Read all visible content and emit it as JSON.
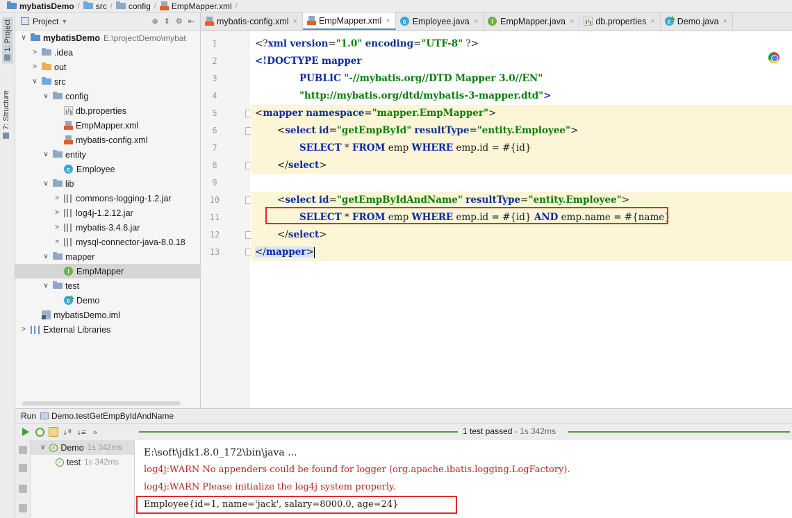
{
  "breadcrumb": {
    "items": [
      "mybatisDemo",
      "src",
      "config",
      "EmpMapper.xml"
    ]
  },
  "tool_strip": {
    "project_tab": "1: Project",
    "structure_tab": "7: Structure"
  },
  "project_panel": {
    "title": "Project",
    "tree": [
      {
        "label": "mybatisDemo",
        "hint": "E:\\projectDemo\\mybat",
        "level": 0,
        "icon": "module-folder-icon",
        "expanded": true
      },
      {
        "label": ".idea",
        "level": 1,
        "icon": "folder-icon",
        "expanded": false
      },
      {
        "label": "out",
        "level": 1,
        "icon": "orange-folder-icon",
        "expanded": false
      },
      {
        "label": "src",
        "level": 1,
        "icon": "source-folder-icon",
        "expanded": true
      },
      {
        "label": "config",
        "level": 2,
        "icon": "folder-icon",
        "expanded": true
      },
      {
        "label": "db.properties",
        "level": 3,
        "icon": "properties-file-icon"
      },
      {
        "label": "EmpMapper.xml",
        "level": 3,
        "icon": "xml-file-icon"
      },
      {
        "label": "mybatis-config.xml",
        "level": 3,
        "icon": "xml-file-icon"
      },
      {
        "label": "entity",
        "level": 2,
        "icon": "folder-icon",
        "expanded": true
      },
      {
        "label": "Employee",
        "level": 3,
        "icon": "class-icon"
      },
      {
        "label": "lib",
        "level": 2,
        "icon": "folder-icon",
        "expanded": true
      },
      {
        "label": "commons-logging-1.2.jar",
        "level": 3,
        "icon": "jar-icon",
        "expanded": false
      },
      {
        "label": "log4j-1.2.12.jar",
        "level": 3,
        "icon": "jar-icon",
        "expanded": false
      },
      {
        "label": "mybatis-3.4.6.jar",
        "level": 3,
        "icon": "jar-icon",
        "expanded": false
      },
      {
        "label": "mysql-connector-java-8.0.18",
        "level": 3,
        "icon": "jar-icon",
        "expanded": false
      },
      {
        "label": "mapper",
        "level": 2,
        "icon": "folder-icon",
        "expanded": true
      },
      {
        "label": "EmpMapper",
        "level": 3,
        "icon": "interface-icon",
        "selected": true
      },
      {
        "label": "test",
        "level": 2,
        "icon": "folder-icon",
        "expanded": true
      },
      {
        "label": "Demo",
        "level": 3,
        "icon": "test-class-icon"
      },
      {
        "label": "mybatisDemo.iml",
        "level": 1,
        "icon": "iml-file-icon"
      },
      {
        "label": "External Libraries",
        "level": 0,
        "icon": "external-libraries-icon",
        "expanded": false
      }
    ]
  },
  "editor_tabs": [
    {
      "label": "mybatis-config.xml",
      "icon": "xml-file-icon",
      "active": false
    },
    {
      "label": "EmpMapper.xml",
      "icon": "xml-file-icon",
      "active": true
    },
    {
      "label": "Employee.java",
      "icon": "class-icon",
      "active": false
    },
    {
      "label": "EmpMapper.java",
      "icon": "interface-icon",
      "active": false
    },
    {
      "label": "db.properties",
      "icon": "properties-file-icon",
      "active": false
    },
    {
      "label": "Demo.java",
      "icon": "test-class-icon",
      "active": false
    }
  ],
  "editor": {
    "line_numbers": [
      "1",
      "2",
      "3",
      "4",
      "5",
      "6",
      "7",
      "8",
      "9",
      "10",
      "11",
      "12",
      "13"
    ],
    "lines": {
      "l1": {
        "open": "<?",
        "tag": "xml",
        "a1": "version",
        "v1": "\"1.0\"",
        "a2": "encoding",
        "v2": "\"UTF-8\"",
        "close": " ?>"
      },
      "l2": {
        "open": "<!",
        "tag": "DOCTYPE",
        "name": "mapper"
      },
      "l3": {
        "kw": "PUBLIC",
        "val": "\"-//mybatis.org//DTD Mapper 3.0//EN\""
      },
      "l4": {
        "val": "\"http://mybatis.org/dtd/mybatis-3-mapper.dtd\"",
        "close": ">"
      },
      "l5": {
        "tag": "mapper",
        "attr": "namespace",
        "val": "\"mapper.EmpMapper\""
      },
      "l6": {
        "tag": "select",
        "a1": "id",
        "v1": "\"getEmpById\"",
        "a2": "resultType",
        "v2": "\"entity.Employee\""
      },
      "l7": {
        "k1": "SELECT",
        "s1": " * ",
        "k2": "FROM",
        "t1": " emp ",
        "k3": "WHERE",
        "t2": " emp.id = #{id}"
      },
      "l8": {
        "tag": "select"
      },
      "l10": {
        "tag": "select",
        "a1": "id",
        "v1": "\"getEmpByIdAndName\"",
        "a2": "resultType",
        "v2": "\"entity.Employee\""
      },
      "l11": {
        "k1": "SELECT",
        "s1": " * ",
        "k2": "FROM",
        "t1": " emp ",
        "k3": "WHERE",
        "t2": " emp.id = #{id} ",
        "k4": "AND",
        "t3": " emp.name = #{name}"
      },
      "l12": {
        "tag": "select"
      },
      "l13": {
        "tag": "mapper"
      }
    }
  },
  "run_panel": {
    "label": "Run",
    "config_name": "Demo.testGetEmpByIdAndName",
    "status": "1 test passed",
    "status_duration": "- 1s 342ms",
    "tree": [
      {
        "label": "Demo",
        "duration": "1s 342ms"
      },
      {
        "label": "test",
        "duration": "1s 342ms"
      }
    ],
    "console": [
      "E:\\soft\\jdk1.8.0_172\\bin\\java ...",
      "log4j:WARN No appenders could be found for logger (org.apache.ibatis.logging.LogFactory).",
      "log4j:WARN Please initialize the log4j system properly.",
      "Employee{id=1, name='jack', salary=8000.0, age=24}"
    ]
  },
  "colors": {
    "highlight_box": "#e32b2b",
    "tag": "#0c2aa3",
    "attr_value": "#087e08",
    "warn_text": "#b3261e"
  }
}
